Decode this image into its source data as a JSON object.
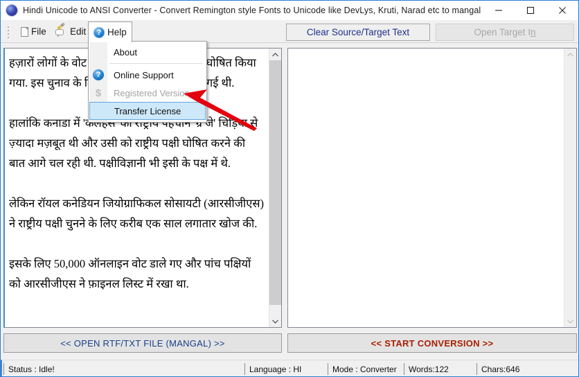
{
  "window": {
    "title": "Hindi Unicode to ANSI Converter - Convert Remington style Fonts to Unicode like DevLys, Kruti, Narad etc to mangal",
    "app_icon": "app-sphere-icon",
    "minimize": "minimize-icon",
    "maximize": "maximize-icon",
    "close": "close-icon",
    "border_color": "#2a7fd4"
  },
  "menubar": {
    "items": [
      {
        "label": "File",
        "icon": "document-icon"
      },
      {
        "label": "Edit",
        "icon": "pencil-edit-icon"
      },
      {
        "label": "Help",
        "icon": "help-circle-icon"
      }
    ]
  },
  "help_menu": {
    "open": true,
    "items": [
      {
        "label": "About",
        "icon": "",
        "state": "normal"
      },
      {
        "label": "Online Support",
        "icon": "help-circle-icon",
        "state": "normal"
      },
      {
        "label": "Registered Version",
        "icon": "dollar-icon",
        "state": "disabled"
      },
      {
        "label": "Transfer License",
        "icon": "",
        "state": "selected"
      }
    ]
  },
  "toolbar": {
    "clear_label": "Clear Source/Target Text",
    "clear_color": "#1f2f8c",
    "open_target_label": "Open Target I",
    "open_target_label_underlined": "n",
    "open_target_disabled": true
  },
  "source_panel": {
    "paragraphs": [
      "हज़ारों लोगों के वोट के बाद 'ग्रे जे' को राष्ट्रीय पक्षी घोषित किया गया. इस चुनाव के लिए ऑनलाइन वोटिंग करवाई गई थी.",
      "हालांकि कनाडा में 'कलहंस' की राष्ट्रीय पहचान 'ग्रे जे' चिड़िया से ज़्यादा मज़बूत थी और उसी को राष्ट्रीय पक्षी घोषित करने की बात आगे चल रही थी. पक्षीविज्ञानी भी इसी के पक्ष में थे.",
      "लेकिन रॉयल कनेडियन जियोग्राफिकल सोसायटी (आरसीजीएस) ने राष्ट्रीय पक्षी चुनने के लिए करीब एक साल लगातार खोज की.",
      "इसके लिए 50,000 ऑनलाइन वोट डाले गए और पांच पक्षियों को आरसीजीएस ने फ़ाइनल लिस्ट में रखा था."
    ],
    "scroll_up": "scroll-up-arrow-icon",
    "scroll_down": "scroll-down-arrow-icon"
  },
  "target_panel": {
    "content": "",
    "scroll_up": "scroll-up-arrow-icon",
    "scroll_down": "scroll-down-arrow-icon"
  },
  "actions": {
    "open_file_label": "<< OPEN RTF/TXT FILE (MANGAL) >>",
    "open_file_color": "#17408b",
    "start_conversion_label": "<< START CONVERSION >>",
    "start_conversion_color": "#a82000"
  },
  "statusbar": {
    "status": "Status :  Idle!",
    "language": "Language : HI",
    "mode": "Mode : Converter",
    "words": "Words:122",
    "chars": "Chars:646"
  },
  "annotation": {
    "arrow": "red-arrow-pointer",
    "color": "#e3000f"
  }
}
